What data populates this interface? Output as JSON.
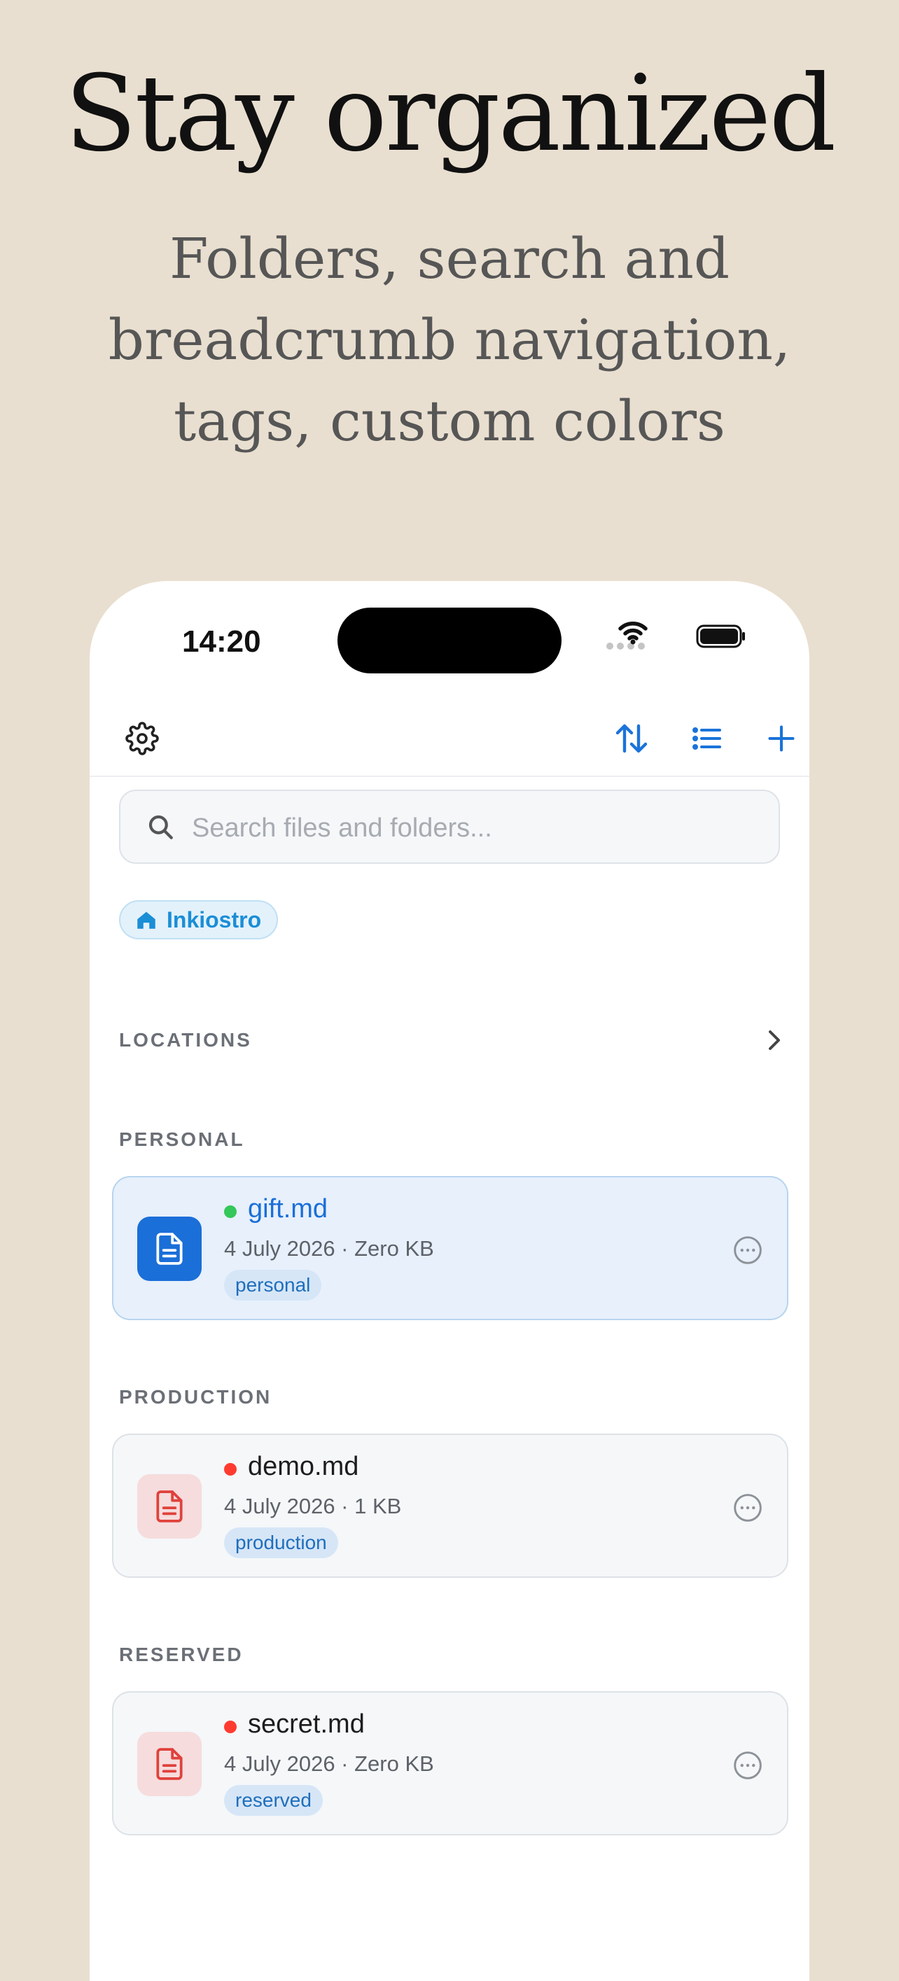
{
  "hero": {
    "title": "Stay organized",
    "subtitle": "Folders, search and breadcrumb navigation, tags, custom colors"
  },
  "status_bar": {
    "time": "14:20"
  },
  "toolbar": {
    "icons": [
      "gear-icon",
      "sort-icon",
      "list-icon",
      "plus-icon"
    ]
  },
  "search": {
    "placeholder": "Search files and folders..."
  },
  "breadcrumb": {
    "label": "Inkiostro",
    "icon": "home-icon"
  },
  "sections": {
    "locations": "LOCATIONS",
    "personal": "PERSONAL",
    "production": "PRODUCTION",
    "reserved": "RESERVED"
  },
  "files": [
    {
      "name": "gift.md",
      "meta": "4 July 2026 · Zero KB",
      "tag": "personal",
      "dot_color": "#34c759",
      "selected": true
    },
    {
      "name": "demo.md",
      "meta": "4 July 2026 · 1 KB",
      "tag": "production",
      "dot_color": "#ff3b30",
      "selected": false
    },
    {
      "name": "secret.md",
      "meta": "4 July 2026 · Zero KB",
      "tag": "reserved",
      "dot_color": "#ff3b30",
      "selected": false
    }
  ],
  "colors": {
    "accent": "#1a73d9",
    "background": "#e9dfd0",
    "danger": "#ff3b30",
    "success": "#34c759"
  }
}
